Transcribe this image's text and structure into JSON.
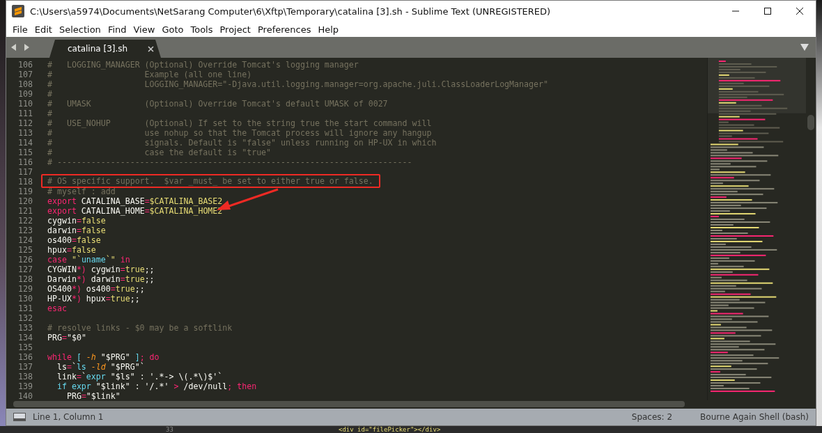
{
  "window": {
    "title": "C:\\Users\\a5974\\Documents\\NetSarang Computer\\6\\Xftp\\Temporary\\catalina [3].sh - Sublime Text (UNREGISTERED)"
  },
  "menu": [
    "File",
    "Edit",
    "Selection",
    "Find",
    "View",
    "Goto",
    "Tools",
    "Project",
    "Preferences",
    "Help"
  ],
  "tabs": [
    {
      "label": "catalina [3].sh",
      "selected": true
    }
  ],
  "lines": [
    {
      "number": "106",
      "tokens": [
        {
          "kind": "comment",
          "text": "#   LOGGING_MANAGER (Optional) Override Tomcat's logging manager"
        }
      ]
    },
    {
      "number": "107",
      "tokens": [
        {
          "kind": "comment",
          "text": "#                   Example (all one line)"
        }
      ]
    },
    {
      "number": "108",
      "tokens": [
        {
          "kind": "comment",
          "text": "#                   LOGGING_MANAGER=\"-Djava.util.logging.manager=org.apache.juli.ClassLoaderLogManager\""
        }
      ]
    },
    {
      "number": "109",
      "tokens": [
        {
          "kind": "comment",
          "text": "#"
        }
      ]
    },
    {
      "number": "110",
      "tokens": [
        {
          "kind": "comment",
          "text": "#   UMASK           (Optional) Override Tomcat's default UMASK of 0027"
        }
      ]
    },
    {
      "number": "111",
      "tokens": [
        {
          "kind": "comment",
          "text": "#"
        }
      ]
    },
    {
      "number": "112",
      "tokens": [
        {
          "kind": "comment",
          "text": "#   USE_NOHUP       (Optional) If set to the string true the start command will"
        }
      ]
    },
    {
      "number": "113",
      "tokens": [
        {
          "kind": "comment",
          "text": "#                   use nohup so that the Tomcat process will ignore any hangup"
        }
      ]
    },
    {
      "number": "114",
      "tokens": [
        {
          "kind": "comment",
          "text": "#                   signals. Default is \"false\" unless running on HP-UX in which"
        }
      ]
    },
    {
      "number": "115",
      "tokens": [
        {
          "kind": "comment",
          "text": "#                   case the default is \"true\""
        }
      ]
    },
    {
      "number": "116",
      "tokens": [
        {
          "kind": "comment",
          "text": "# -------------------------------------------------------------------------"
        }
      ]
    },
    {
      "number": "117"
    },
    {
      "number": "118",
      "boxed": true,
      "tokens": [
        {
          "kind": "comment",
          "text": "# OS specific support.  $var _must_ be set to either true or false."
        }
      ]
    },
    {
      "number": "119",
      "tokens": [
        {
          "kind": "comment",
          "text": "# myself : add"
        }
      ]
    },
    {
      "number": "120",
      "tokens": [
        {
          "kind": "keyword",
          "text": "export"
        },
        {
          "kind": "plain",
          "text": " CATALINA_BASE"
        },
        {
          "kind": "keyword",
          "text": "="
        },
        {
          "kind": "string",
          "text": "$CATALINA_BASE2"
        }
      ]
    },
    {
      "number": "121",
      "pointed": true,
      "tokens": [
        {
          "kind": "keyword",
          "text": "export"
        },
        {
          "kind": "plain",
          "text": " CATALINA_HOME"
        },
        {
          "kind": "keyword",
          "text": "="
        },
        {
          "kind": "string",
          "text": "$CATALINA_HOME2"
        }
      ]
    },
    {
      "number": "122",
      "tokens": [
        {
          "kind": "plain",
          "text": "cygwin"
        },
        {
          "kind": "keyword",
          "text": "="
        },
        {
          "kind": "string",
          "text": "false"
        }
      ]
    },
    {
      "number": "123",
      "tokens": [
        {
          "kind": "plain",
          "text": "darwin"
        },
        {
          "kind": "keyword",
          "text": "="
        },
        {
          "kind": "string",
          "text": "false"
        }
      ]
    },
    {
      "number": "124",
      "tokens": [
        {
          "kind": "plain",
          "text": "os400"
        },
        {
          "kind": "keyword",
          "text": "="
        },
        {
          "kind": "string",
          "text": "false"
        }
      ]
    },
    {
      "number": "125",
      "tokens": [
        {
          "kind": "plain",
          "text": "hpux"
        },
        {
          "kind": "keyword",
          "text": "="
        },
        {
          "kind": "string",
          "text": "false"
        }
      ]
    },
    {
      "number": "126",
      "tokens": [
        {
          "kind": "keyword",
          "text": "case"
        },
        {
          "kind": "string",
          "text": " \"`"
        },
        {
          "kind": "builtin",
          "text": "uname"
        },
        {
          "kind": "string",
          "text": "`\""
        },
        {
          "kind": "keyword",
          "text": " in"
        }
      ]
    },
    {
      "number": "127",
      "tokens": [
        {
          "kind": "plain",
          "text": "CYGWIN"
        },
        {
          "kind": "keyword",
          "text": "*)"
        },
        {
          "kind": "plain",
          "text": " cygwin"
        },
        {
          "kind": "keyword",
          "text": "="
        },
        {
          "kind": "string",
          "text": "true"
        },
        {
          "kind": "plain",
          "text": ";;"
        }
      ]
    },
    {
      "number": "128",
      "tokens": [
        {
          "kind": "plain",
          "text": "Darwin"
        },
        {
          "kind": "keyword",
          "text": "*)"
        },
        {
          "kind": "plain",
          "text": " darwin"
        },
        {
          "kind": "keyword",
          "text": "="
        },
        {
          "kind": "string",
          "text": "true"
        },
        {
          "kind": "plain",
          "text": ";;"
        }
      ]
    },
    {
      "number": "129",
      "tokens": [
        {
          "kind": "plain",
          "text": "OS400"
        },
        {
          "kind": "keyword",
          "text": "*)"
        },
        {
          "kind": "plain",
          "text": " os400"
        },
        {
          "kind": "keyword",
          "text": "="
        },
        {
          "kind": "string",
          "text": "true"
        },
        {
          "kind": "plain",
          "text": ";;"
        }
      ]
    },
    {
      "number": "130",
      "tokens": [
        {
          "kind": "plain",
          "text": "HP-UX"
        },
        {
          "kind": "keyword",
          "text": "*)"
        },
        {
          "kind": "plain",
          "text": " hpux"
        },
        {
          "kind": "keyword",
          "text": "="
        },
        {
          "kind": "string",
          "text": "true"
        },
        {
          "kind": "plain",
          "text": ";;"
        }
      ]
    },
    {
      "number": "131",
      "tokens": [
        {
          "kind": "keyword",
          "text": "esac"
        }
      ]
    },
    {
      "number": "132"
    },
    {
      "number": "133",
      "tokens": [
        {
          "kind": "comment",
          "text": "# resolve links - $0 may be a softlink"
        }
      ]
    },
    {
      "number": "134",
      "tokens": [
        {
          "kind": "plain",
          "text": "PRG"
        },
        {
          "kind": "keyword",
          "text": "="
        },
        {
          "kind": "plain",
          "text": "\"$0\""
        }
      ]
    },
    {
      "number": "135"
    },
    {
      "number": "136",
      "tokens": [
        {
          "kind": "keyword",
          "text": "while"
        },
        {
          "kind": "builtin",
          "text": " ["
        },
        {
          "kind": "param",
          "text": " -h"
        },
        {
          "kind": "plain",
          "text": " \"$PRG\" "
        },
        {
          "kind": "builtin",
          "text": "]"
        },
        {
          "kind": "keyword",
          "text": "; do"
        }
      ]
    },
    {
      "number": "137",
      "tokens": [
        {
          "kind": "plain",
          "text": "  ls"
        },
        {
          "kind": "keyword",
          "text": "="
        },
        {
          "kind": "plain",
          "text": "`"
        },
        {
          "kind": "builtin",
          "text": "ls"
        },
        {
          "kind": "param",
          "text": " -ld"
        },
        {
          "kind": "plain",
          "text": " \"$PRG\"`"
        }
      ]
    },
    {
      "number": "138",
      "tokens": [
        {
          "kind": "plain",
          "text": "  link"
        },
        {
          "kind": "keyword",
          "text": "="
        },
        {
          "kind": "plain",
          "text": "`"
        },
        {
          "kind": "builtin",
          "text": "expr"
        },
        {
          "kind": "plain",
          "text": " \"$ls\" : '.*-> \\(.*\\)$'`"
        }
      ]
    },
    {
      "number": "139",
      "tokens": [
        {
          "kind": "builtin",
          "text": "  if expr"
        },
        {
          "kind": "plain",
          "text": " \"$link\" : '/.*' "
        },
        {
          "kind": "keyword",
          "text": ">"
        },
        {
          "kind": "plain",
          "text": " /dev/null"
        },
        {
          "kind": "keyword",
          "text": "; then"
        }
      ]
    },
    {
      "number": "140",
      "tokens": [
        {
          "kind": "plain",
          "text": "    PRG"
        },
        {
          "kind": "keyword",
          "text": "="
        },
        {
          "kind": "plain",
          "text": "\"$link\""
        }
      ]
    }
  ],
  "status_bar": {
    "position": "Line 1, Column 1",
    "indentation": "Spaces: 2",
    "syntax": "Bourne Again Shell (bash)"
  },
  "background_window": {
    "line_number": "33",
    "code": "<div id=\"filePicker\"></div>"
  }
}
